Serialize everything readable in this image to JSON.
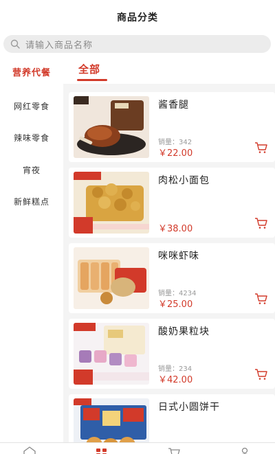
{
  "header": {
    "title": "商品分类"
  },
  "search": {
    "placeholder": "请输入商品名称"
  },
  "sidebar": {
    "items": [
      {
        "label": "营养代餐",
        "active": true
      },
      {
        "label": "网红零食",
        "active": false
      },
      {
        "label": "辣味零食",
        "active": false
      },
      {
        "label": "宵夜",
        "active": false
      },
      {
        "label": "新鲜糕点",
        "active": false
      }
    ]
  },
  "main": {
    "tabs": [
      {
        "label": "全部",
        "active": true
      }
    ],
    "products": [
      {
        "name": "酱香腿",
        "sales": "销量：342",
        "price": "￥22.00"
      },
      {
        "name": "肉松小面包",
        "sales": "",
        "price": "￥38.00"
      },
      {
        "name": "咪咪虾味",
        "sales": "销量：4234",
        "price": "￥25.00"
      },
      {
        "name": "酸奶果粒块",
        "sales": "销量：234",
        "price": "￥42.00"
      },
      {
        "name": "日式小圆饼干",
        "sales": "",
        "price": ""
      }
    ]
  },
  "bottom_nav": {
    "icons": [
      "home-icon",
      "category-icon",
      "cart-icon",
      "user-icon"
    ]
  },
  "colors": {
    "accent": "#d23a2a",
    "content_bg": "#f4f4f4",
    "search_bg": "#ececec"
  }
}
